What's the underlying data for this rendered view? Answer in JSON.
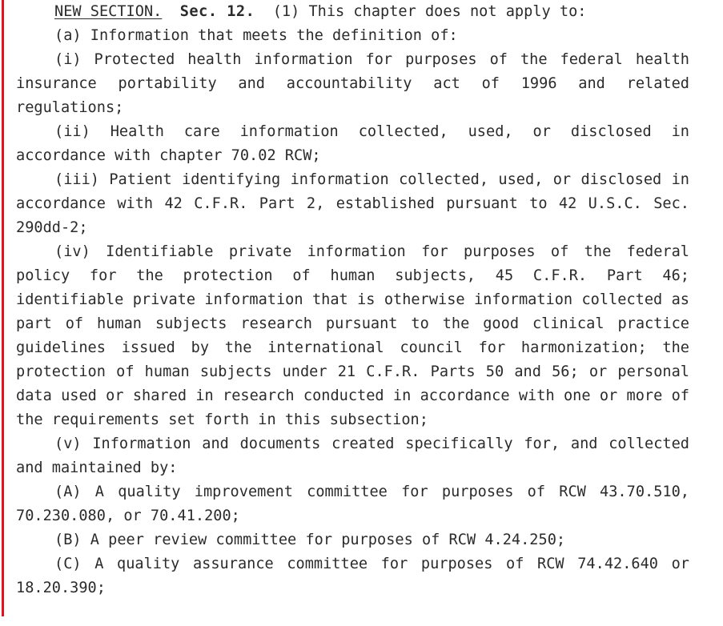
{
  "document": {
    "type": "legislative-bill-text",
    "background_color": "#ffffff",
    "text_color": "#2b2b2b",
    "change_bar_color": "#e31419",
    "heading": {
      "new_section_label": "NEW SECTION.",
      "section_number": "Sec. 12.",
      "lead_in": "(1) This chapter does not apply to:"
    },
    "paragraphs": [
      {
        "id": "a",
        "marker": "(a)",
        "text": "(a) Information that meets the definition of:"
      },
      {
        "id": "i",
        "marker": "(i)",
        "text": "(i) Protected health information for purposes of the federal health insurance portability and accountability act of 1996 and related regulations;"
      },
      {
        "id": "ii",
        "marker": "(ii)",
        "text": "(ii) Health care information collected, used, or disclosed in accordance with chapter 70.02 RCW;"
      },
      {
        "id": "iii",
        "marker": "(iii)",
        "text": "(iii) Patient identifying information collected, used, or disclosed in accordance with 42 C.F.R. Part 2, established pursuant to 42 U.S.C. Sec. 290dd-2;"
      },
      {
        "id": "iv",
        "marker": "(iv)",
        "text": "(iv) Identifiable private information for purposes of the federal policy for the protection of human subjects, 45 C.F.R. Part 46; identifiable private information that is otherwise information collected as part of human subjects research pursuant to the good clinical practice guidelines issued by the international council for harmonization; the protection of human subjects under 21 C.F.R. Parts 50 and 56; or personal data used or shared in research conducted in accordance with one or more of the requirements set forth in this subsection;"
      },
      {
        "id": "v",
        "marker": "(v)",
        "text": "(v) Information and documents created specifically for, and collected and maintained by:"
      },
      {
        "id": "A",
        "marker": "(A)",
        "text": "(A) A quality improvement committee for purposes of RCW 43.70.510, 70.230.080, or 70.41.200;"
      },
      {
        "id": "B",
        "marker": "(B)",
        "text": "(B) A peer review committee for purposes of RCW 4.24.250;"
      },
      {
        "id": "C",
        "marker": "(C)",
        "text": "(C) A quality assurance committee for purposes of RCW 74.42.640 or 18.20.390;"
      }
    ]
  }
}
